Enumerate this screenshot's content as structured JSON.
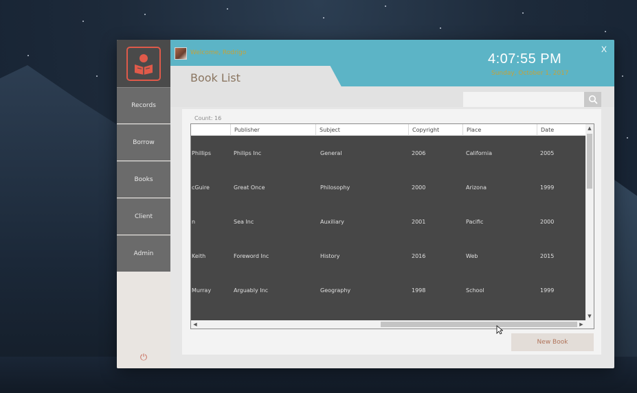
{
  "window": {
    "welcome_text": "Welcome, Rodrigo",
    "clock_time": "4:07:55 PM",
    "clock_date": "Sunday, October 1, 2017",
    "close_label": "X",
    "page_title": "Book List"
  },
  "sidebar": {
    "items": [
      {
        "label": "Records"
      },
      {
        "label": "Borrow"
      },
      {
        "label": "Books"
      },
      {
        "label": "Client"
      },
      {
        "label": "Admin"
      }
    ],
    "logo_icon": "reader-icon",
    "power_icon": "power-icon"
  },
  "search": {
    "value": "",
    "placeholder": "",
    "icon": "search-icon"
  },
  "table": {
    "count_label": "Count: 16",
    "columns": [
      "",
      "Publisher",
      "Subject",
      "Copyright",
      "Place",
      "Date"
    ],
    "rows": [
      [
        "Phillips",
        "Philips Inc",
        "General",
        "2006",
        "California",
        "2005"
      ],
      [
        "cGuire",
        "Great Once",
        "Philosophy",
        "2000",
        "Arizona",
        "1999"
      ],
      [
        "n",
        "Sea Inc",
        "Auxiliary",
        "2001",
        "Pacific",
        "2000"
      ],
      [
        "Keith",
        "Foreword Inc",
        "History",
        "2016",
        "Web",
        "2015"
      ],
      [
        "Murray",
        "Arguably Inc",
        "Geography",
        "1998",
        "School",
        "1999"
      ]
    ]
  },
  "actions": {
    "new_book_label": "New Book"
  },
  "colors": {
    "accent_teal": "#5cb4c6",
    "sidebar_gray": "#6b6b6b",
    "logo_red": "#e05a4a",
    "gold_text": "#c2a33d",
    "table_bg": "#474747"
  }
}
